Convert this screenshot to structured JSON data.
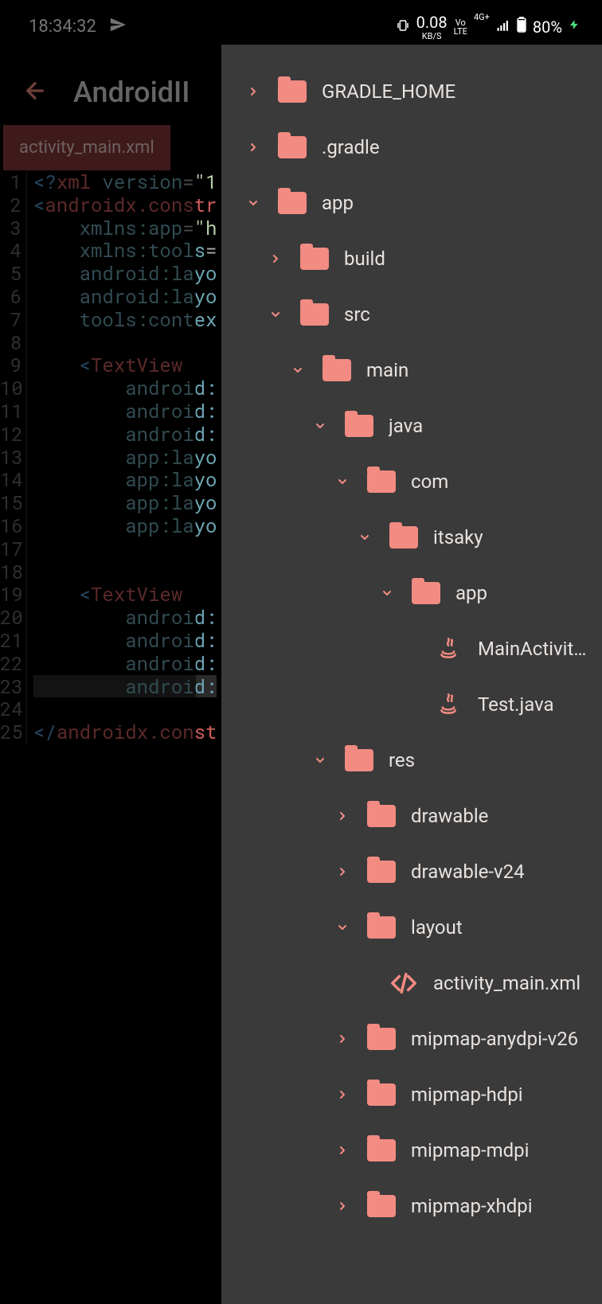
{
  "status": {
    "time": "18:34:32",
    "net_speed": "0.08",
    "net_unit": "KB/S",
    "lte_top": "Vo",
    "lte_bot": "LTE",
    "signal": "4G+",
    "battery": "80%"
  },
  "appbar": {
    "title": "AndroidII"
  },
  "tab": {
    "label": "activity_main.xml"
  },
  "editor": {
    "lines": [
      {
        "n": "1",
        "segs": [
          {
            "t": "<?",
            "c": "tk-decl"
          },
          {
            "t": "xml ",
            "c": "tk-tag"
          },
          {
            "t": "version",
            "c": "tk-attr"
          },
          {
            "t": "=",
            "c": "tk-punc"
          },
          {
            "t": "\"1",
            "c": "tk-str"
          }
        ]
      },
      {
        "n": "2",
        "segs": [
          {
            "t": "<",
            "c": "tk-decl"
          },
          {
            "t": "androidx.constr",
            "c": "tk-tag"
          }
        ]
      },
      {
        "n": "3",
        "segs": [
          {
            "t": "    ",
            "c": ""
          },
          {
            "t": "xmlns:app",
            "c": "tk-attr"
          },
          {
            "t": "=",
            "c": "tk-punc"
          },
          {
            "t": "\"h",
            "c": "tk-str"
          }
        ]
      },
      {
        "n": "4",
        "segs": [
          {
            "t": "    ",
            "c": ""
          },
          {
            "t": "xmlns:tools",
            "c": "tk-attr"
          },
          {
            "t": "=",
            "c": "tk-punc"
          }
        ]
      },
      {
        "n": "5",
        "segs": [
          {
            "t": "    ",
            "c": ""
          },
          {
            "t": "android:layo",
            "c": "tk-attr"
          }
        ]
      },
      {
        "n": "6",
        "segs": [
          {
            "t": "    ",
            "c": ""
          },
          {
            "t": "android:layo",
            "c": "tk-attr"
          }
        ]
      },
      {
        "n": "7",
        "segs": [
          {
            "t": "    ",
            "c": ""
          },
          {
            "t": "tools:contex",
            "c": "tk-attr"
          }
        ]
      },
      {
        "n": "8",
        "segs": []
      },
      {
        "n": "9",
        "segs": [
          {
            "t": "    ",
            "c": ""
          },
          {
            "t": "<",
            "c": "tk-decl"
          },
          {
            "t": "TextView",
            "c": "tk-tag"
          }
        ]
      },
      {
        "n": "10",
        "segs": [
          {
            "t": "        ",
            "c": ""
          },
          {
            "t": "android:",
            "c": "tk-attr"
          }
        ]
      },
      {
        "n": "11",
        "segs": [
          {
            "t": "        ",
            "c": ""
          },
          {
            "t": "android:",
            "c": "tk-attr"
          }
        ]
      },
      {
        "n": "12",
        "segs": [
          {
            "t": "        ",
            "c": ""
          },
          {
            "t": "android:",
            "c": "tk-attr"
          }
        ]
      },
      {
        "n": "13",
        "segs": [
          {
            "t": "        ",
            "c": ""
          },
          {
            "t": "app:layo",
            "c": "tk-attr"
          }
        ]
      },
      {
        "n": "14",
        "segs": [
          {
            "t": "        ",
            "c": ""
          },
          {
            "t": "app:layo",
            "c": "tk-attr"
          }
        ]
      },
      {
        "n": "15",
        "segs": [
          {
            "t": "        ",
            "c": ""
          },
          {
            "t": "app:layo",
            "c": "tk-attr"
          }
        ]
      },
      {
        "n": "16",
        "segs": [
          {
            "t": "        ",
            "c": ""
          },
          {
            "t": "app:layo",
            "c": "tk-attr"
          }
        ]
      },
      {
        "n": "17",
        "segs": []
      },
      {
        "n": "18",
        "segs": []
      },
      {
        "n": "19",
        "segs": [
          {
            "t": "    ",
            "c": ""
          },
          {
            "t": "<",
            "c": "tk-decl"
          },
          {
            "t": "TextView",
            "c": "tk-tag"
          }
        ]
      },
      {
        "n": "20",
        "segs": [
          {
            "t": "        ",
            "c": ""
          },
          {
            "t": "android:",
            "c": "tk-attr"
          }
        ]
      },
      {
        "n": "21",
        "segs": [
          {
            "t": "        ",
            "c": ""
          },
          {
            "t": "android:",
            "c": "tk-attr"
          }
        ]
      },
      {
        "n": "22",
        "segs": [
          {
            "t": "        ",
            "c": ""
          },
          {
            "t": "android:",
            "c": "tk-attr"
          }
        ]
      },
      {
        "n": "23",
        "hl": true,
        "segs": [
          {
            "t": "        ",
            "c": ""
          },
          {
            "t": "android:",
            "c": "tk-attr"
          }
        ]
      },
      {
        "n": "24",
        "segs": []
      },
      {
        "n": "25",
        "segs": [
          {
            "t": "</",
            "c": "tk-close"
          },
          {
            "t": "androidx.const",
            "c": "tk-tag"
          }
        ]
      }
    ]
  },
  "tree": [
    {
      "depth": 0,
      "chev": "right",
      "icon": "folder",
      "label": "GRADLE_HOME"
    },
    {
      "depth": 0,
      "chev": "right",
      "icon": "folder",
      "label": ".gradle"
    },
    {
      "depth": 0,
      "chev": "down",
      "icon": "folder",
      "label": "app"
    },
    {
      "depth": 1,
      "chev": "right",
      "icon": "folder",
      "label": "build"
    },
    {
      "depth": 1,
      "chev": "down",
      "icon": "folder",
      "label": "src"
    },
    {
      "depth": 2,
      "chev": "down",
      "icon": "folder",
      "label": "main"
    },
    {
      "depth": 3,
      "chev": "down",
      "icon": "folder",
      "label": "java"
    },
    {
      "depth": 4,
      "chev": "down",
      "icon": "folder",
      "label": "com"
    },
    {
      "depth": 5,
      "chev": "down",
      "icon": "folder",
      "label": "itsaky"
    },
    {
      "depth": 6,
      "chev": "down",
      "icon": "folder",
      "label": "app"
    },
    {
      "depth": 7,
      "chev": "none",
      "icon": "java",
      "label": "MainActivity.java"
    },
    {
      "depth": 7,
      "chev": "none",
      "icon": "java",
      "label": "Test.java"
    },
    {
      "depth": 3,
      "chev": "down",
      "icon": "folder",
      "label": "res"
    },
    {
      "depth": 4,
      "chev": "right",
      "icon": "folder",
      "label": "drawable"
    },
    {
      "depth": 4,
      "chev": "right",
      "icon": "folder",
      "label": "drawable-v24"
    },
    {
      "depth": 4,
      "chev": "down",
      "icon": "folder",
      "label": "layout"
    },
    {
      "depth": 5,
      "chev": "none",
      "icon": "xml",
      "label": "activity_main.xml"
    },
    {
      "depth": 4,
      "chev": "right",
      "icon": "folder",
      "label": "mipmap-anydpi-v26"
    },
    {
      "depth": 4,
      "chev": "right",
      "icon": "folder",
      "label": "mipmap-hdpi"
    },
    {
      "depth": 4,
      "chev": "right",
      "icon": "folder",
      "label": "mipmap-mdpi"
    },
    {
      "depth": 4,
      "chev": "right",
      "icon": "folder",
      "label": "mipmap-xhdpi"
    }
  ]
}
